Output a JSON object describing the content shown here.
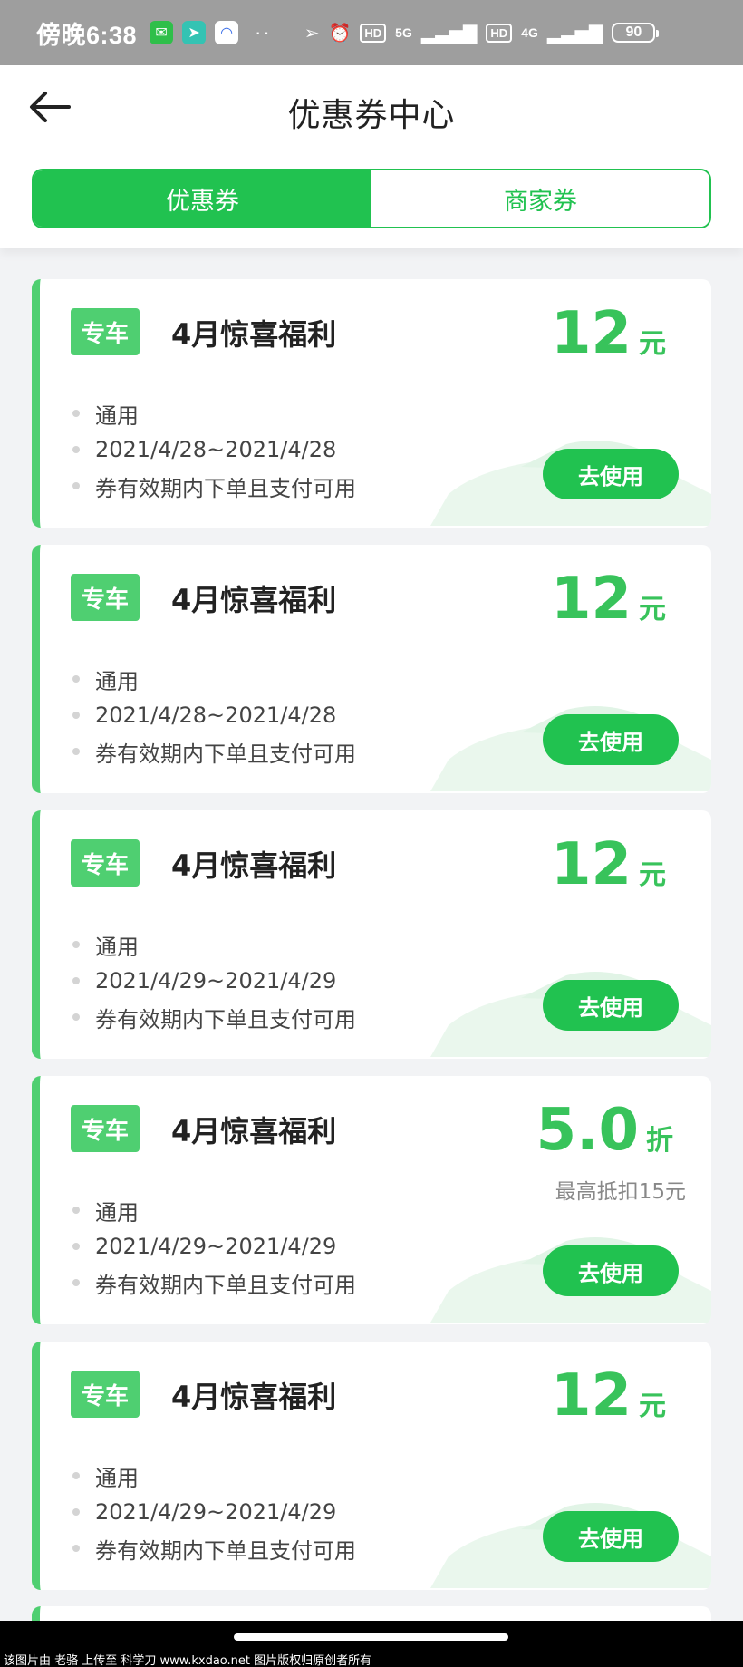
{
  "status_bar": {
    "time": "傍晚6:38",
    "dots": "··",
    "hd1": "HD",
    "net1": "5G",
    "hd2": "HD",
    "net2": "4G",
    "battery": "90"
  },
  "header": {
    "back_icon": "back-arrow-icon",
    "title": "优惠券中心",
    "tabs": [
      {
        "label": "优惠券",
        "active": true
      },
      {
        "label": "商家券",
        "active": false
      }
    ]
  },
  "coupons": [
    {
      "tag": "专车",
      "title": "4月惊喜福利",
      "amount": "12",
      "unit": "元",
      "note": "",
      "lines": [
        "通用",
        "2021/4/28~2021/4/28",
        "券有效期内下单且支付可用"
      ],
      "button": "去使用"
    },
    {
      "tag": "专车",
      "title": "4月惊喜福利",
      "amount": "12",
      "unit": "元",
      "note": "",
      "lines": [
        "通用",
        "2021/4/28~2021/4/28",
        "券有效期内下单且支付可用"
      ],
      "button": "去使用"
    },
    {
      "tag": "专车",
      "title": "4月惊喜福利",
      "amount": "12",
      "unit": "元",
      "note": "",
      "lines": [
        "通用",
        "2021/4/29~2021/4/29",
        "券有效期内下单且支付可用"
      ],
      "button": "去使用"
    },
    {
      "tag": "专车",
      "title": "4月惊喜福利",
      "amount": "5.0",
      "unit": "折",
      "note": "最高抵扣15元",
      "lines": [
        "通用",
        "2021/4/29~2021/4/29",
        "券有效期内下单且支付可用"
      ],
      "button": "去使用"
    },
    {
      "tag": "专车",
      "title": "4月惊喜福利",
      "amount": "12",
      "unit": "元",
      "note": "",
      "lines": [
        "通用",
        "2021/4/29~2021/4/29",
        "券有效期内下单且支付可用"
      ],
      "button": "去使用"
    }
  ],
  "footer": {
    "watermark": "该图片由 老骆 上传至 科学刀 www.kxdao.net 图片版权归原创者所有"
  },
  "colors": {
    "accent": "#21c250",
    "tag_green": "#4fcf71",
    "amount_green": "#38c35b",
    "status_bar": "#9e9e9e"
  }
}
